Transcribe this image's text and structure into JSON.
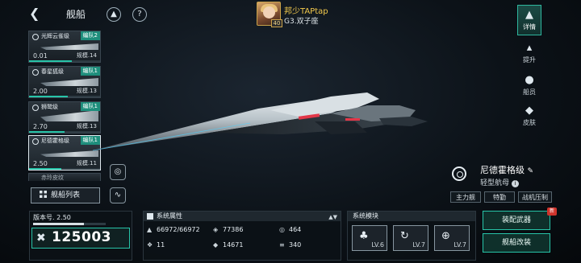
{
  "header": {
    "back_icon": "back-arrow-icon",
    "title": "舰船",
    "ship_icon": "rocket-icon",
    "help_label": "?"
  },
  "player": {
    "name": "邦少TAPtap",
    "level": "40",
    "sub_title": "G3.双子座"
  },
  "ship_list": [
    {
      "name": "光辉云雀级",
      "fleet": "编队2",
      "cost": "0.01",
      "scale": "规模.14",
      "bar": 0.6
    },
    {
      "name": "春星狐级",
      "fleet": "编队1",
      "cost": "2.00",
      "scale": "规模.13",
      "bar": 0.55
    },
    {
      "name": "狮鹫级",
      "fleet": "编队1",
      "cost": "2.70",
      "scale": "规模.13",
      "bar": 0.5
    },
    {
      "name": "尼德霍格级",
      "fleet": "编队1",
      "cost": "2.50",
      "scale": "规模.11",
      "bar": 0.45,
      "selected": true
    }
  ],
  "ship_list_partial": "赤玲皮纹",
  "list_button_label": "舰船列表",
  "right_nav": [
    {
      "label": "详情",
      "icon": "detail-icon",
      "active": true
    },
    {
      "label": "提升",
      "icon": "upgrade-icon"
    },
    {
      "label": "船员",
      "icon": "crew-icon"
    },
    {
      "label": "皮肤",
      "icon": "skin-icon"
    }
  ],
  "ship_info": {
    "class_name": "尼德霍格级",
    "type": "轻型航母",
    "tags": [
      "主力舰",
      "特勤",
      "战机压制"
    ]
  },
  "version": {
    "label": "版本号. 2.50",
    "power": "125003",
    "progress": 0.7
  },
  "attributes": {
    "title": "系统属性",
    "items": [
      {
        "icon": "hull-icon",
        "value": "66972/66972"
      },
      {
        "icon": "armor-icon",
        "value": "77386"
      },
      {
        "icon": "shield-icon",
        "value": "464"
      },
      {
        "icon": "weapon-icon",
        "value": "11"
      },
      {
        "icon": "firepower-icon",
        "value": "14671"
      },
      {
        "icon": "speed-icon",
        "value": "340"
      }
    ]
  },
  "modules": {
    "title": "系统模块",
    "slots": [
      {
        "icon": "shield-module-icon",
        "level": "LV.6"
      },
      {
        "icon": "engine-module-icon",
        "level": "LV.7"
      },
      {
        "icon": "targeting-module-icon",
        "level": "LV.7"
      }
    ]
  },
  "actions": {
    "equip_label": "装配武器",
    "modify_label": "舰船改装",
    "new_badge": "新"
  }
}
